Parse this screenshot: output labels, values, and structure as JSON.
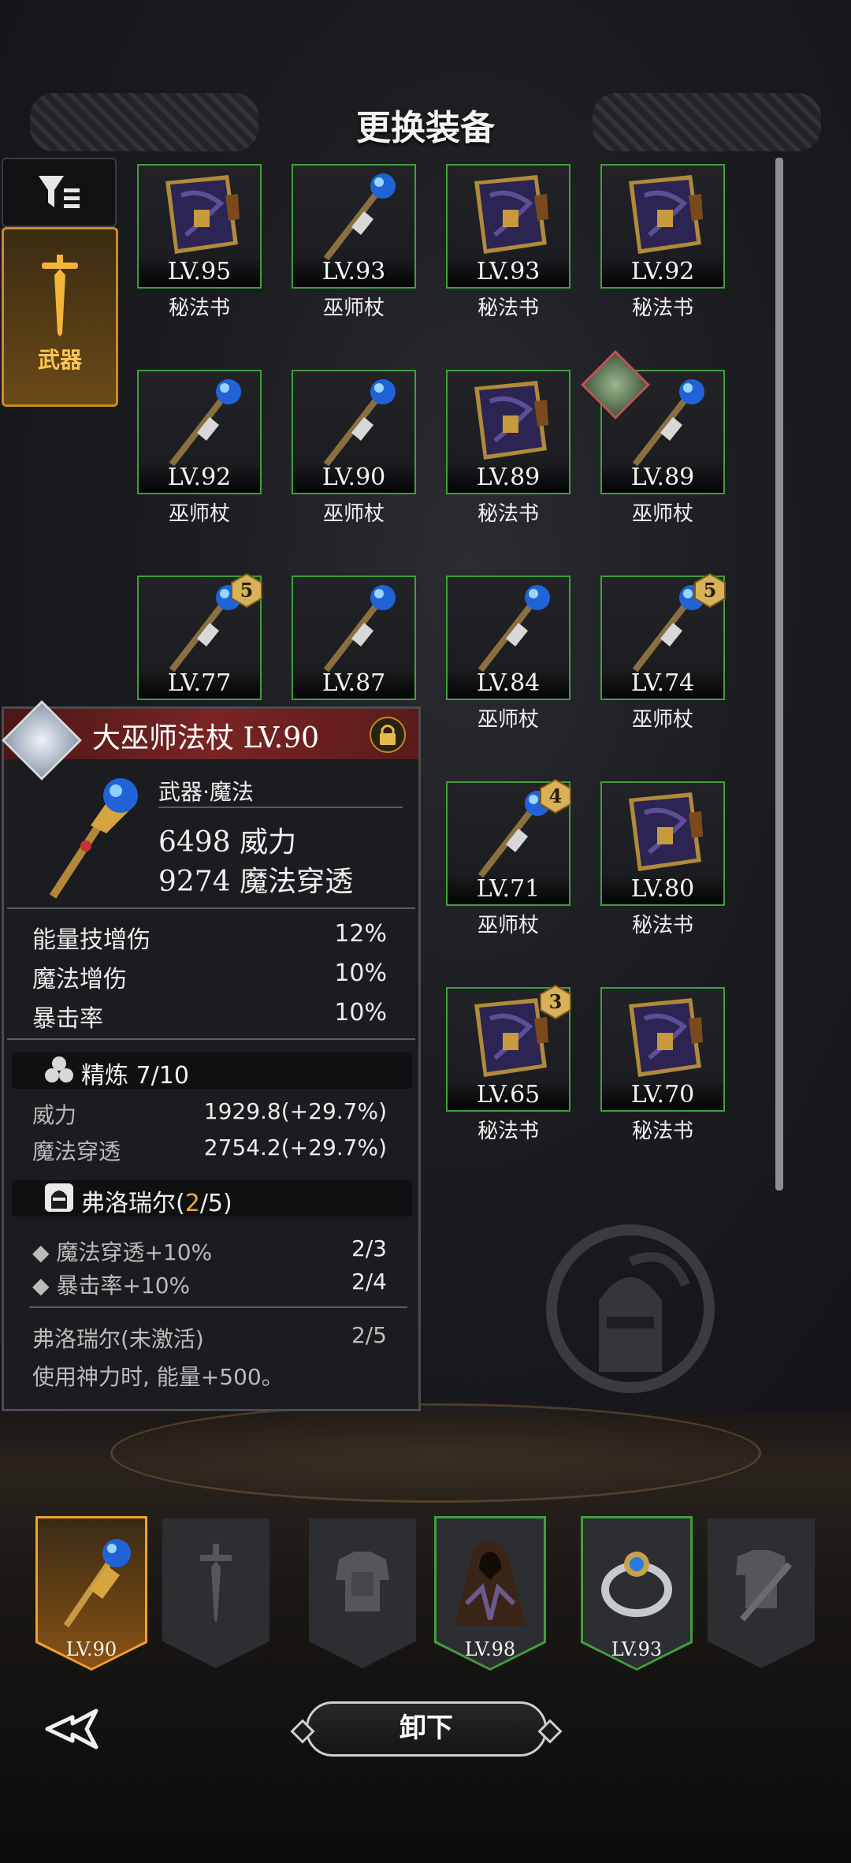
{
  "header": {
    "title": "更换装备"
  },
  "sidebar": {
    "weapon_tab_label": "武器",
    "filter_icon": "filter-sort-icon"
  },
  "inventory": [
    {
      "level": "LV.95",
      "name": "秘法书",
      "type": "book"
    },
    {
      "level": "LV.93",
      "name": "巫师杖",
      "type": "staff"
    },
    {
      "level": "LV.93",
      "name": "秘法书",
      "type": "book"
    },
    {
      "level": "LV.92",
      "name": "秘法书",
      "type": "book"
    },
    {
      "level": "LV.92",
      "name": "巫师杖",
      "type": "staff"
    },
    {
      "level": "LV.90",
      "name": "巫师杖",
      "type": "staff"
    },
    {
      "level": "LV.89",
      "name": "秘法书",
      "type": "book"
    },
    {
      "level": "LV.89",
      "name": "巫师杖",
      "type": "staff",
      "equipped_by_portrait": true
    },
    {
      "level": "LV.77",
      "name": "",
      "type": "staff",
      "refine": "5"
    },
    {
      "level": "LV.87",
      "name": "",
      "type": "staff"
    },
    {
      "level": "LV.84",
      "name": "巫师杖",
      "type": "staff"
    },
    {
      "level": "LV.74",
      "name": "巫师杖",
      "type": "staff",
      "refine": "5"
    },
    {
      "level": "LV.71",
      "name": "巫师杖",
      "type": "staff",
      "refine": "4"
    },
    {
      "level": "LV.80",
      "name": "秘法书",
      "type": "book"
    },
    {
      "level": "LV.65",
      "name": "秘法书",
      "type": "book",
      "refine": "3"
    },
    {
      "level": "LV.70",
      "name": "秘法书",
      "type": "book"
    }
  ],
  "detail": {
    "name": "大巫师法杖 LV.90",
    "type": "武器·魔法",
    "stat1_value": "6498",
    "stat1_label": "威力",
    "stat2_value": "9274",
    "stat2_label": "魔法穿透",
    "bonuses": [
      {
        "label": "能量技增伤",
        "value": "12%"
      },
      {
        "label": "魔法增伤",
        "value": "10%"
      },
      {
        "label": "暴击率",
        "value": "10%"
      }
    ],
    "refine": {
      "title": "精炼 7/10",
      "rows": [
        {
          "label": "威力",
          "value": "1929.8(+29.7%)"
        },
        {
          "label": "魔法穿透",
          "value": "2754.2(+29.7%)"
        }
      ]
    },
    "set": {
      "name": "弗洛瑞尔(",
      "count": "2",
      "total": "/5)",
      "rows": [
        {
          "label": "魔法穿透+10%",
          "value": "2/3"
        },
        {
          "label": "暴击率+10%",
          "value": "2/4"
        }
      ],
      "inactive_title": "弗洛瑞尔(未激活)",
      "inactive_value": "2/5",
      "inactive_desc": "使用神力时, 能量+500。"
    }
  },
  "slots": [
    {
      "level": "LV.90",
      "state": "active",
      "icon": "staff-icon"
    },
    {
      "level": "",
      "state": "empty",
      "icon": "sword-icon"
    },
    {
      "level": "",
      "state": "empty",
      "icon": "armor-icon"
    },
    {
      "level": "LV.98",
      "state": "equipped",
      "icon": "cloak-icon"
    },
    {
      "level": "LV.93",
      "state": "equipped",
      "icon": "ring-icon"
    },
    {
      "level": "",
      "state": "empty",
      "icon": "armor-sword-icon"
    }
  ],
  "footer": {
    "unequip_label": "卸下",
    "back_icon": "back-arrow-icon"
  },
  "colors": {
    "frame_green": "#3f9f3b",
    "accent_orange": "#f2a02c",
    "header_red": "#7a2424"
  }
}
